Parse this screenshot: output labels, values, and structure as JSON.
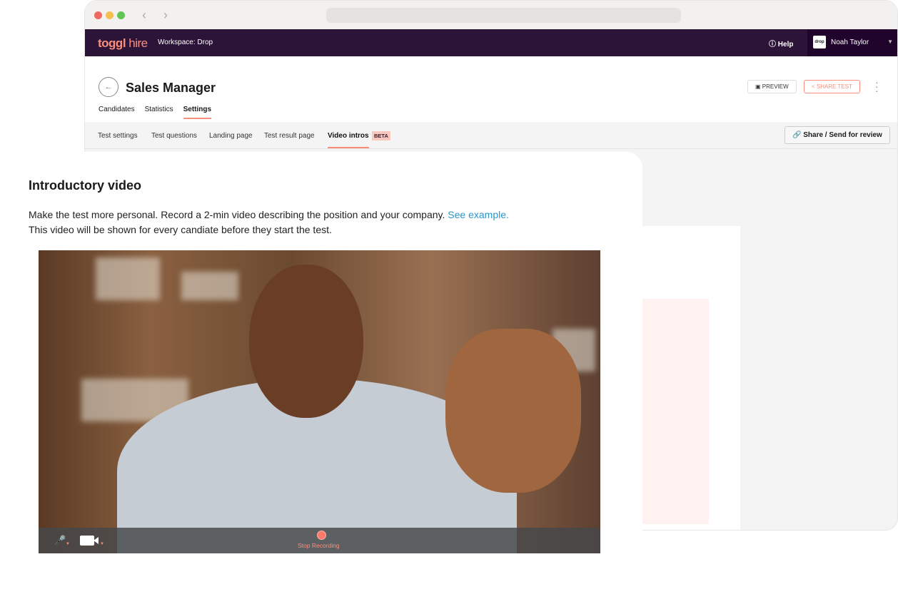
{
  "browser": {
    "traffic_colors": [
      "#ed6a5e",
      "#f5bf4f",
      "#61c554"
    ]
  },
  "topbar": {
    "logo_main": "toggl",
    "logo_sub": "hire",
    "workspace": "Workspace: Drop",
    "help": "Help",
    "user_logo": "drop",
    "user_name": "Noah Taylor"
  },
  "header": {
    "title": "Sales Manager",
    "tabs": [
      {
        "label": "Candidates"
      },
      {
        "label": "Statistics"
      },
      {
        "label": "Settings",
        "active": true
      }
    ],
    "preview": "PREVIEW",
    "share_test": "SHARE TEST"
  },
  "subtabs": {
    "items": [
      "Test settings",
      "Test questions",
      "Landing page",
      "Test result page",
      "Video intros"
    ],
    "badge": "BETA",
    "review_button": "Share / Send for review"
  },
  "card": {
    "title": "Introductory video",
    "desc_line1": "Make the test more personal. Record a 2-min video describing the position and your company.",
    "link": "See example.",
    "desc_line2": "This video will be shown for every candiate before they start the test."
  },
  "video": {
    "stop_label": "Stop Recording"
  },
  "colors": {
    "accent": "#fb8e7a",
    "topbar": "#2c1338",
    "link": "#2a95c8"
  }
}
